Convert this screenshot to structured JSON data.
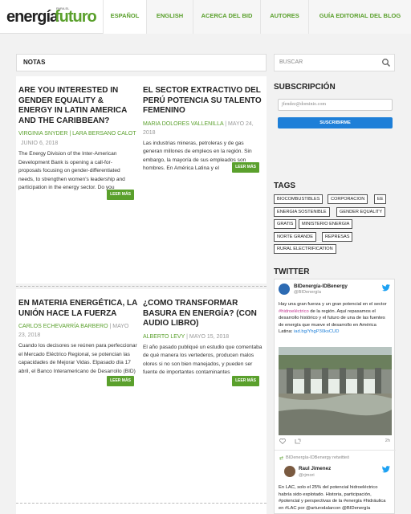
{
  "logo": {
    "part1": "energía",
    "part2": "futuro",
    "small": "PARA EL"
  },
  "nav": {
    "items": [
      "ESPAÑOL",
      "ENGLISH",
      "ACERCA DEL BID",
      "AUTORES",
      "GUÍA EDITORIAL DEL BLOG"
    ]
  },
  "notas": {
    "title": "NOTAS"
  },
  "posts": [
    {
      "title": "ARE YOU INTERESTED IN GENDER EQUALITY & ENERGY IN LATIN AMERICA AND THE CARIBBEAN?",
      "author": "VIRGINIA SNYDER | LARA BERSANO CALOT",
      "date": "JUNIO 6, 2018",
      "excerpt": "The Energy Division of the Inter-American Development Bank is opening a call-for-proposals focusing on gender-differentiated needs, to strengthen women's leadership and participation in the energy sector. Do you",
      "button": "LEER MÁS"
    },
    {
      "title": "EL SECTOR EXTRACTIVO DEL PERÚ POTENCIA SU TALENTO FEMENINO",
      "author": "MARIA DOLORES VALLENILLA",
      "date": "MAYO 24, 2018",
      "excerpt": "Las industrias mineras, petroleras y de gas generan millones de empleos en la región. Sin embargo, la mayoría de sus empleados son hombres. En América Latina y el",
      "button": "LEER MÁS"
    },
    {
      "title": "EN MATERIA ENERGÉTICA, LA UNIÓN HACE LA FUERZA",
      "author": "CARLOS ECHEVARRÍA BARBERO",
      "date": "MAYO 23, 2018",
      "excerpt": "Cuando los decisores se reúnen para perfeccionar el Mercado Eléctrico Regional, se potencian las capacidades de Mejorar Vidas. Elpasado día 17 abril, el Banco Interamericano de Desarrollo (BID)",
      "button": "LEER MÁS"
    },
    {
      "title": "¿COMO TRANSFORMAR BASURA EN ENERGÍA? (CON AUDIO LIBRO)",
      "author": "ALBERTO LEVY",
      "date": "MAYO 15, 2018",
      "excerpt": "El año pasado publiqué un estudio que comentaba de qué manera los vertederos, producen malos olores si no son bien manejados, y pueden ser fuente de importantes contaminantes",
      "button": "LEER MÁS"
    }
  ],
  "search": {
    "placeholder": "BUSCAR"
  },
  "subscription": {
    "title": "SUBSCRIPCIÓN",
    "placeholder": "jfendez@dominio.com",
    "button": "SUSCRIBIRME"
  },
  "tags": {
    "title": "TAGS",
    "items": [
      "BIOCOMBUSTIBLES",
      "CORPORACION",
      "EE",
      "ENERGIA SOSTENIBLE",
      "GENDER EQUALITY",
      "GRATIS",
      "MINISTERIO ENERGIA",
      "NORTE GRANDE",
      "REPRESAS",
      "RURAL ELECTRIFICATION"
    ]
  },
  "twitter": {
    "title": "TWITTER",
    "tweet1": {
      "name": "BIDenergía-IDBenergy",
      "handle": "@BIDenergía",
      "text_a": "Hay una gran fuerza y un gran potencial en el sector ",
      "hashtag": "#hidroeléctrico",
      "text_b": " de la región. Aquí repasamos el desarrollo histórico y el futuro de una de las fuentes de energía que mueve el desarrollo en América Latina: ",
      "link": "iad.bg/YhgP30ksCUD",
      "time": "2h"
    },
    "retweet_note": "BIDenergía-IDBenergy retwitteó",
    "tweet2": {
      "name": "Raul Jimenez",
      "handle": "@rjmori",
      "text": "En LAC, solo el 25% del potencial hidroeléctrico habría sido explotado. Historia, participación, #potencial y perspectivas de la #energía #hidráulica en #LAC por @arturodalarcon @BIDenergía"
    }
  },
  "colors": {
    "accent": "#5aa02c",
    "blue": "#1e7fd8"
  }
}
